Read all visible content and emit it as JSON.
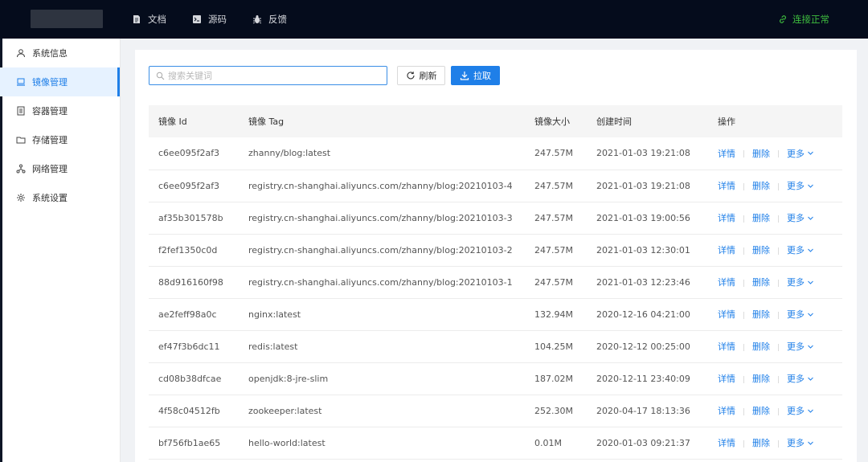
{
  "header": {
    "nav": [
      {
        "label": "文档",
        "icon": "document-icon"
      },
      {
        "label": "源码",
        "icon": "terminal-icon"
      },
      {
        "label": "反馈",
        "icon": "bug-icon"
      }
    ],
    "status": {
      "label": "连接正常",
      "color": "#3fbf3f",
      "icon": "link-icon"
    }
  },
  "sidebar": {
    "items": [
      {
        "label": "系统信息",
        "icon": "user-icon"
      },
      {
        "label": "镜像管理",
        "icon": "laptop-icon",
        "active": true
      },
      {
        "label": "容器管理",
        "icon": "container-icon"
      },
      {
        "label": "存储管理",
        "icon": "folder-icon"
      },
      {
        "label": "网络管理",
        "icon": "network-icon"
      },
      {
        "label": "系统设置",
        "icon": "gear-icon"
      }
    ]
  },
  "toolbar": {
    "search_placeholder": "搜索关键词",
    "refresh_label": "刷新",
    "pull_label": "拉取"
  },
  "table": {
    "columns": [
      "镜像 Id",
      "镜像 Tag",
      "镜像大小",
      "创建时间",
      "操作"
    ],
    "actions": {
      "detail": "详情",
      "delete": "删除",
      "more": "更多"
    },
    "rows": [
      {
        "id": "c6ee095f2af3",
        "tag": "zhanny/blog:latest",
        "size": "247.57M",
        "created": "2021-01-03 19:21:08"
      },
      {
        "id": "c6ee095f2af3",
        "tag": "registry.cn-shanghai.aliyuncs.com/zhanny/blog:20210103-4",
        "size": "247.57M",
        "created": "2021-01-03 19:21:08"
      },
      {
        "id": "af35b301578b",
        "tag": "registry.cn-shanghai.aliyuncs.com/zhanny/blog:20210103-3",
        "size": "247.57M",
        "created": "2021-01-03 19:00:56"
      },
      {
        "id": "f2fef1350c0d",
        "tag": "registry.cn-shanghai.aliyuncs.com/zhanny/blog:20210103-2",
        "size": "247.57M",
        "created": "2021-01-03 12:30:01"
      },
      {
        "id": "88d916160f98",
        "tag": "registry.cn-shanghai.aliyuncs.com/zhanny/blog:20210103-1",
        "size": "247.57M",
        "created": "2021-01-03 12:23:46"
      },
      {
        "id": "ae2feff98a0c",
        "tag": "nginx:latest",
        "size": "132.94M",
        "created": "2020-12-16 04:21:00"
      },
      {
        "id": "ef47f3b6dc11",
        "tag": "redis:latest",
        "size": "104.25M",
        "created": "2020-12-12 00:25:00"
      },
      {
        "id": "cd08b38dfcae",
        "tag": "openjdk:8-jre-slim",
        "size": "187.02M",
        "created": "2020-12-11 23:40:09"
      },
      {
        "id": "4f58c04512fb",
        "tag": "zookeeper:latest",
        "size": "252.30M",
        "created": "2020-04-17 18:13:36"
      },
      {
        "id": "bf756fb1ae65",
        "tag": "hello-world:latest",
        "size": "0.01M",
        "created": "2020-01-03 09:21:37"
      }
    ]
  },
  "colors": {
    "accent": "#1f7fe8",
    "header_bg": "#050c1c",
    "active_bg": "#e6f2ff"
  }
}
